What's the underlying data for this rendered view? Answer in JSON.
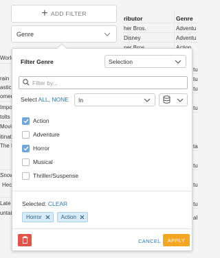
{
  "sidebar": {
    "add_filter_label": "ADD FILTER",
    "filter_field_label": "Genre"
  },
  "background_table": {
    "headers": [
      "ributor",
      "Genre"
    ],
    "left_fragments": [
      "World",
      "rain",
      "astic",
      "omer",
      "Impo",
      "tolts",
      "Movie",
      "itinat",
      "The L",
      "Snow",
      "Hec",
      "Late",
      "untai"
    ],
    "distributor_cells": [
      "her Bros.",
      "Disney",
      "ner Bros."
    ],
    "genre_cells": [
      "Adventu",
      "Adventu",
      "Action",
      "ture",
      "ture",
      "ture",
      "ture",
      "tal",
      "ture",
      "ture",
      "ture",
      "al"
    ]
  },
  "popup": {
    "title": "Filter Genre",
    "mode_value": "Selection",
    "search_placeholder": "Filter by...",
    "select_label": "Select",
    "select_all": "ALL",
    "select_none": "NONE",
    "operator_value": "In",
    "options": [
      {
        "label": "Action",
        "checked": true
      },
      {
        "label": "Adventure",
        "checked": false
      },
      {
        "label": "Horror",
        "checked": true
      },
      {
        "label": "Musical",
        "checked": false
      },
      {
        "label": "Thriller/Suspense",
        "checked": false
      }
    ],
    "selected_label": "Selected:",
    "clear_label": "CLEAR",
    "chips": [
      "Horror",
      "Action"
    ],
    "cancel_label": "CANCEL",
    "apply_label": "APPLY"
  },
  "colors": {
    "accent": "#2a7ab8",
    "apply": "#f5a623",
    "delete": "#e05547",
    "checkbox_on": "#6fa6dc",
    "chip_bg": "#d7ebf8"
  }
}
